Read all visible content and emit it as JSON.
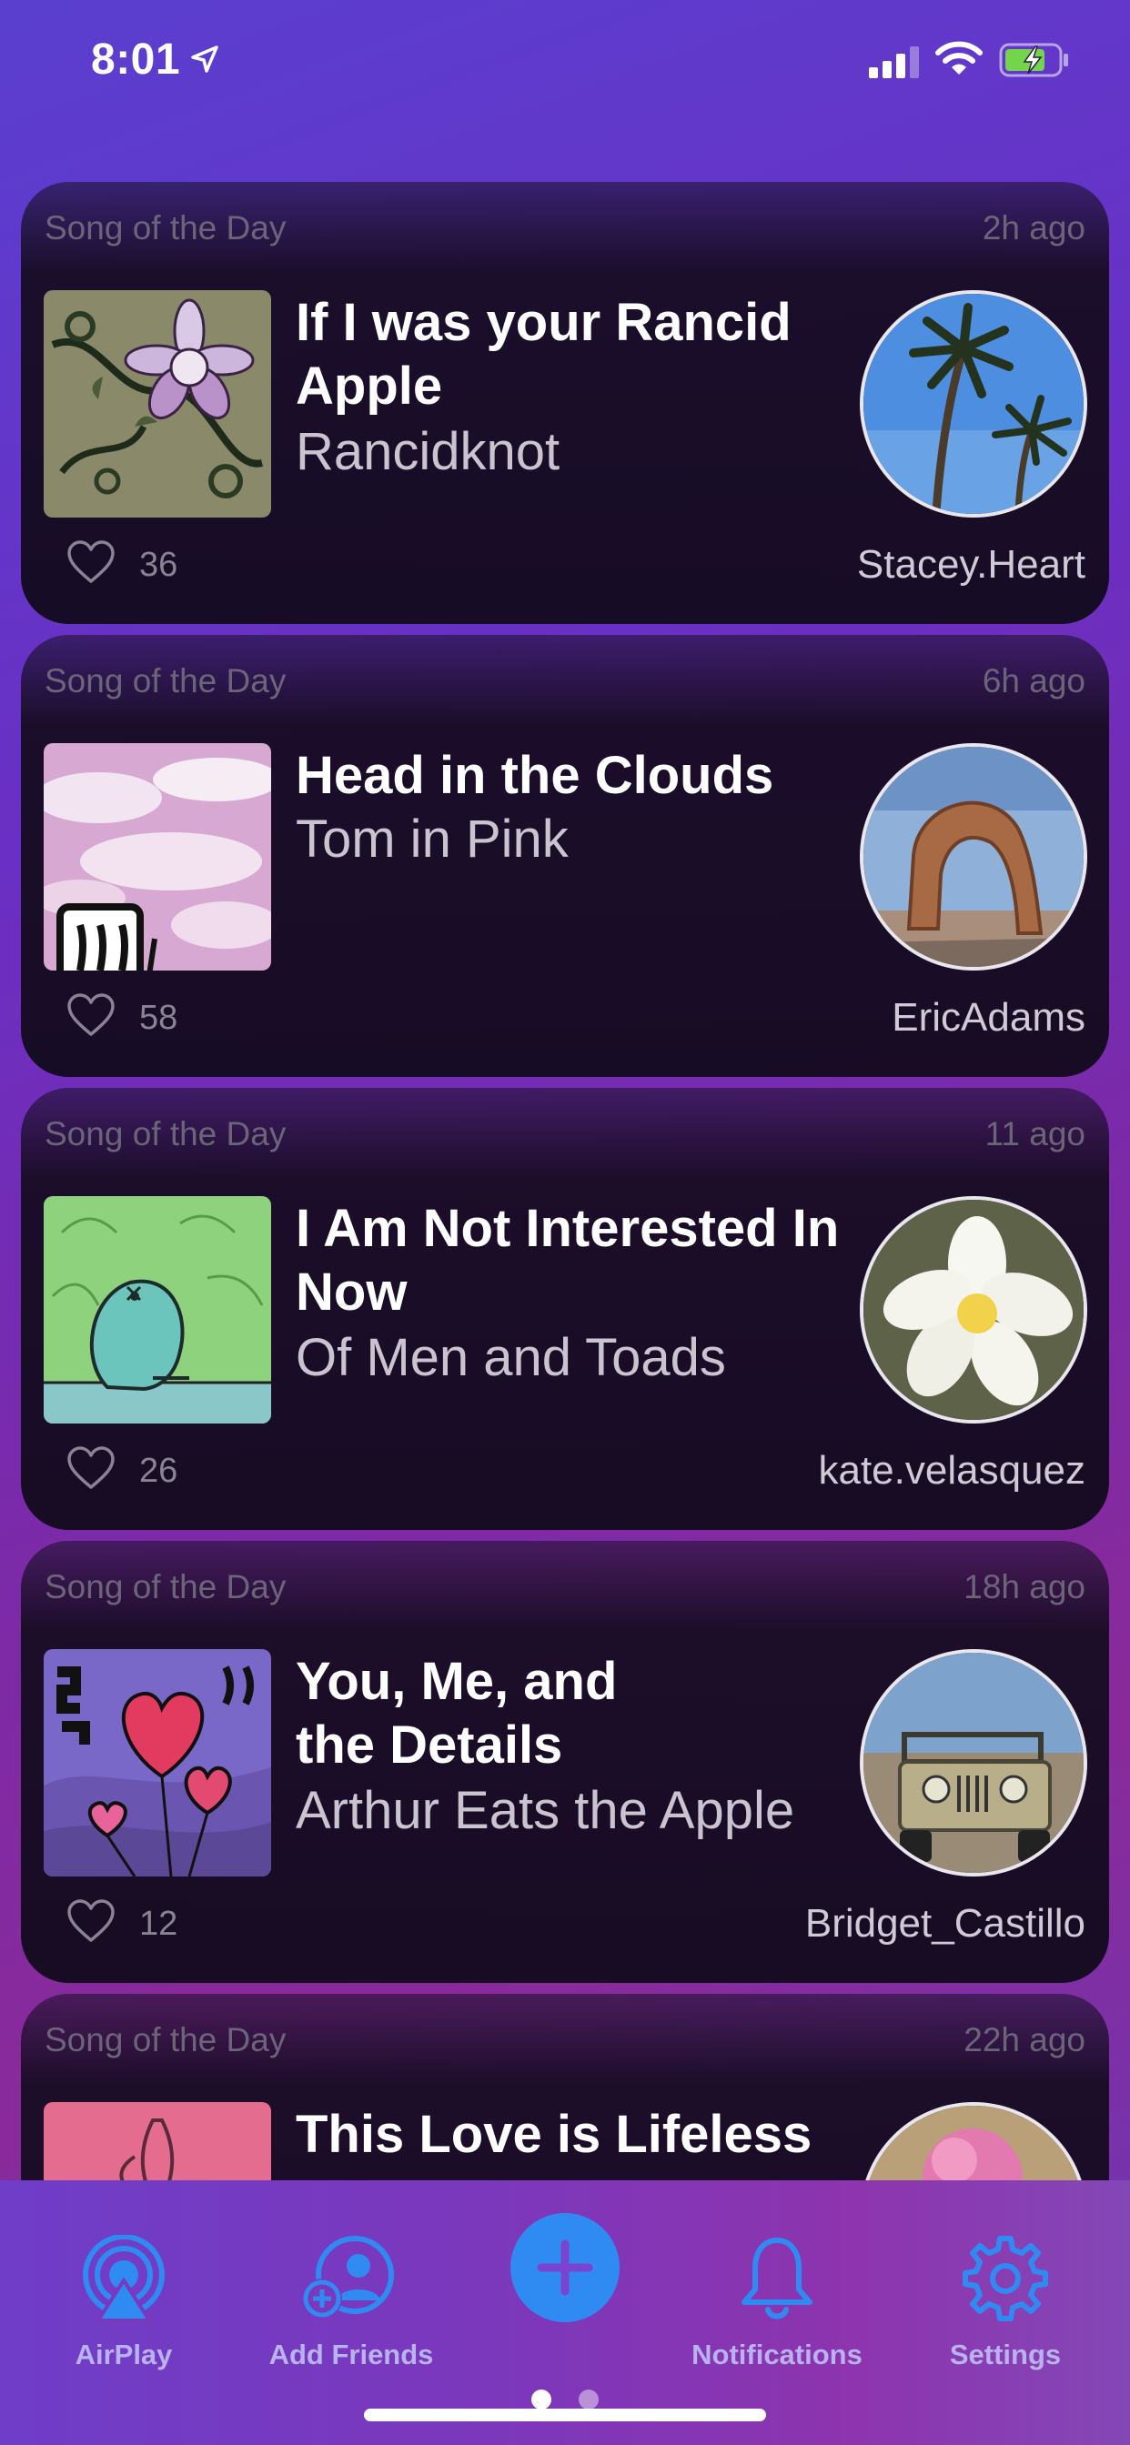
{
  "status_bar": {
    "time": "8:01"
  },
  "feed": {
    "cards": [
      {
        "label": "Song of the Day",
        "time_ago": "2h ago",
        "title": "If I was your Rancid Apple",
        "artist": "Rancidknot",
        "likes": "36",
        "username": "Stacey.Heart",
        "album_icon": "floral-vine-album-art",
        "avatar_icon": "palm-trees-avatar"
      },
      {
        "label": "Song of the Day",
        "time_ago": "6h ago",
        "title": "Head in the Clouds",
        "artist": "Tom in Pink",
        "likes": "58",
        "username": "EricAdams",
        "album_icon": "pink-clouds-album-art",
        "avatar_icon": "stone-arch-avatar"
      },
      {
        "label": "Song of the Day",
        "time_ago": "11 ago",
        "title": "I Am Not Interested In Now",
        "artist": "Of Men and Toads",
        "likes": "26",
        "username": "kate.velasquez",
        "album_icon": "green-frog-album-art",
        "avatar_icon": "white-flower-avatar"
      },
      {
        "label": "Song of the Day",
        "time_ago": "18h ago",
        "title": "You, Me, and the Details",
        "artist": "Arthur Eats the Apple",
        "likes": "12",
        "username": "Bridget_Castillo",
        "album_icon": "heart-balloons-album-art",
        "avatar_icon": "old-jeep-avatar"
      },
      {
        "label": "Song of the Day",
        "time_ago": "22h ago",
        "title": "This Love is Lifeless",
        "artist": "",
        "likes": "",
        "username": "",
        "album_icon": "pink-plant-album-art",
        "avatar_icon": "pink-flower-avatar"
      }
    ]
  },
  "tab_bar": {
    "items": [
      {
        "label": "AirPlay",
        "icon": "airplay-icon"
      },
      {
        "label": "Add Friends",
        "icon": "add-friend-icon"
      },
      {
        "label": "",
        "icon": "plus-icon"
      },
      {
        "label": "Notifications",
        "icon": "bell-icon"
      },
      {
        "label": "Settings",
        "icon": "gear-icon"
      }
    ],
    "page_indicator": {
      "pages": 2,
      "current": 1
    }
  },
  "colors": {
    "accent_blue": "#2f8bf2",
    "tab_label": "#b9b2ee",
    "card_bg": "#170d24"
  }
}
